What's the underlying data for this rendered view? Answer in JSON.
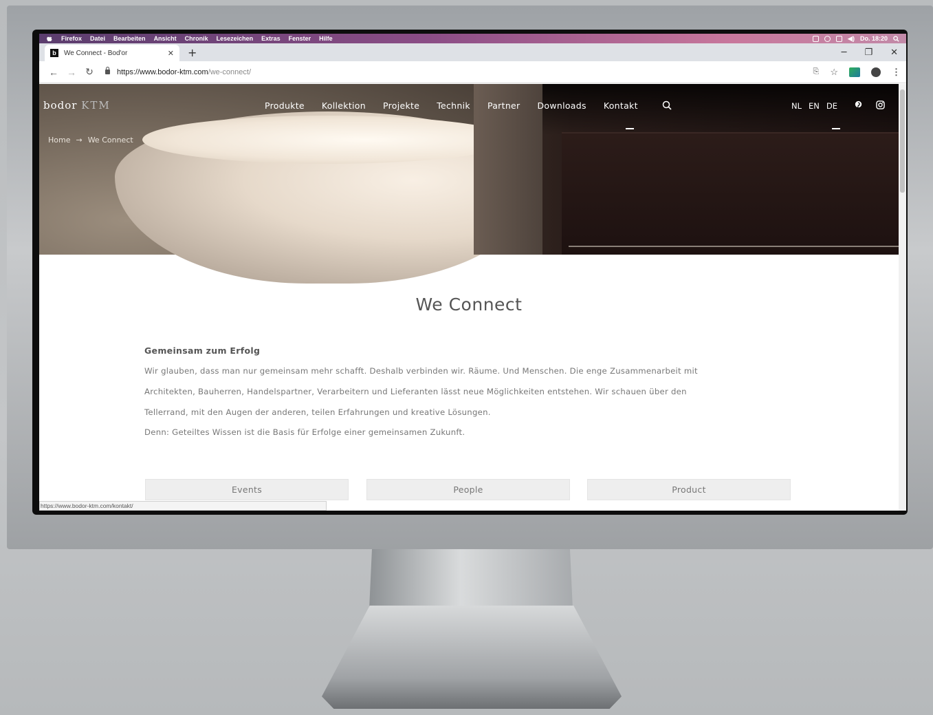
{
  "menubar": {
    "items": [
      "Firefox",
      "Datei",
      "Bearbeiten",
      "Ansicht",
      "Chronik",
      "Lesezeichen",
      "Extras",
      "Fenster",
      "Hilfe"
    ],
    "clock": "Do. 18:20"
  },
  "browser": {
    "tab_title": "We Connect - Bod'or",
    "favicon_letter": "b",
    "url_host": "https://www.bodor-ktm.com",
    "url_path": "/we-connect/",
    "status_url": "https://www.bodor-ktm.com/kontakt/"
  },
  "site": {
    "logo_main": "bodor",
    "logo_sub": "KTM",
    "nav": [
      "Produkte",
      "Kollektion",
      "Projekte",
      "Technik",
      "Partner",
      "Downloads",
      "Kontakt"
    ],
    "languages": [
      "NL",
      "EN",
      "DE"
    ],
    "breadcrumb": {
      "home": "Home",
      "separator": "→",
      "current": "We Connect"
    }
  },
  "content": {
    "title": "We Connect",
    "heading": "Gemeinsam zum Erfolg",
    "paragraph_lines": [
      "Wir glauben, dass man nur gemeinsam mehr schafft. Deshalb verbinden wir. Räume. Und Menschen. Die enge Zusammenarbeit mit",
      "Architekten, Bauherren, Handelspartner, Verarbeitern und Lieferanten lässt neue Möglichkeiten entstehen. Wir schauen über den",
      "Tellerrand, mit den Augen der anderen, teilen Erfahrungen und kreative Lösungen.",
      "Denn: Geteiltes Wissen ist die Basis für Erfolge einer gemeinsamen Zukunft."
    ],
    "categories": [
      "Events",
      "People",
      "Product"
    ]
  },
  "icons": {
    "search": "search-icon",
    "pinterest": "pinterest-icon",
    "instagram": "instagram-icon"
  }
}
